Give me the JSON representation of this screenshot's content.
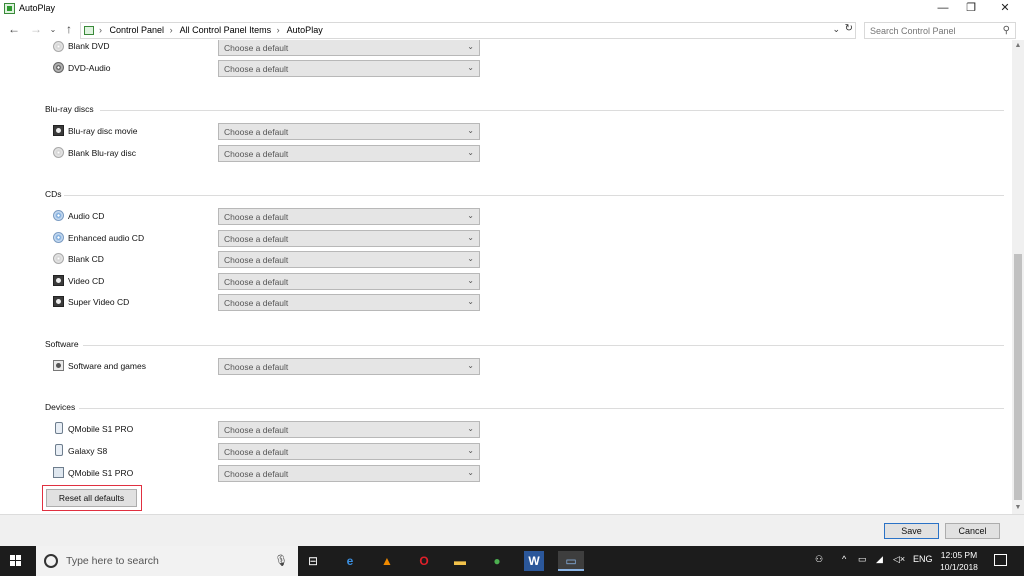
{
  "window": {
    "title": "AutoPlay",
    "minimize_glyph": "—",
    "restore_glyph": "❐",
    "close_glyph": "✕"
  },
  "address": {
    "crumbs": [
      "Control Panel",
      "All Control Panel Items",
      "AutoPlay"
    ],
    "search_placeholder": "Search Control Panel"
  },
  "sections": [
    {
      "label": "",
      "items": [
        {
          "name": "Blank DVD",
          "icon": "blank-disc-icon",
          "value": "Choose a default"
        },
        {
          "name": "DVD-Audio",
          "icon": "dvd-audio-icon",
          "value": "Choose a default"
        }
      ]
    },
    {
      "label": "Blu-ray discs",
      "items": [
        {
          "name": "Blu-ray disc movie",
          "icon": "bluray-movie-icon",
          "value": "Choose a default"
        },
        {
          "name": "Blank Blu-ray disc",
          "icon": "blank-disc-icon",
          "value": "Choose a default"
        }
      ]
    },
    {
      "label": "CDs",
      "items": [
        {
          "name": "Audio CD",
          "icon": "audio-cd-icon",
          "value": "Choose a default"
        },
        {
          "name": "Enhanced audio CD",
          "icon": "audio-cd-icon",
          "value": "Choose a default"
        },
        {
          "name": "Blank CD",
          "icon": "blank-disc-icon",
          "value": "Choose a default"
        },
        {
          "name": "Video CD",
          "icon": "video-cd-icon",
          "value": "Choose a default"
        },
        {
          "name": "Super Video CD",
          "icon": "video-cd-icon",
          "value": "Choose a default"
        }
      ]
    },
    {
      "label": "Software",
      "items": [
        {
          "name": "Software and games",
          "icon": "software-icon",
          "value": "Choose a default"
        }
      ]
    },
    {
      "label": "Devices",
      "items": [
        {
          "name": "QMobile S1 PRO",
          "icon": "phone-icon",
          "value": "Choose a default"
        },
        {
          "name": "Galaxy S8",
          "icon": "phone-icon",
          "value": "Choose a default"
        },
        {
          "name": "QMobile S1 PRO",
          "icon": "media-device-icon",
          "value": "Choose a default"
        }
      ]
    }
  ],
  "reset_label": "Reset all defaults",
  "footer": {
    "save_label": "Save",
    "cancel_label": "Cancel"
  },
  "taskbar": {
    "search_placeholder": "Type here to search",
    "apps": [
      "task-view-icon",
      "edge-icon",
      "vlc-icon",
      "opera-icon",
      "file-explorer-icon",
      "chrome-icon",
      "word-icon",
      "control-panel-icon"
    ],
    "language": "ENG",
    "time": "12:05 PM",
    "date": "10/1/2018"
  }
}
